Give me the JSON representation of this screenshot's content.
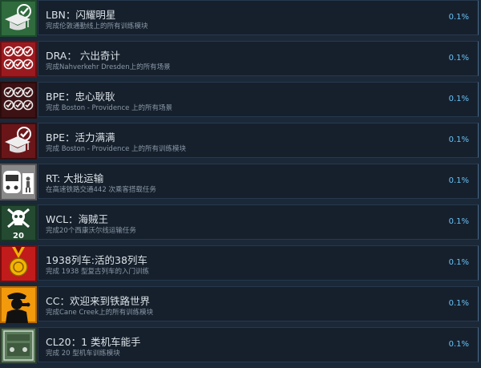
{
  "achievements": [
    {
      "title": "LBN：闪耀明星",
      "desc": "完成伦敦通勤线上的所有训练模块",
      "percent": "0.1%",
      "icon": "graduation-cap-icon"
    },
    {
      "title": "DRA： 六出奇计",
      "desc": "完成Nahverkehr Dresden上的所有场景",
      "percent": "0.1%",
      "icon": "six-checkmarks-icon"
    },
    {
      "title": "BPE：忠心耿耿",
      "desc": "完成 Boston - Providence 上的所有场景",
      "percent": "0.1%",
      "icon": "six-checkmarks-icon"
    },
    {
      "title": "BPE：活力满满",
      "desc": "完成 Boston - Providence 上的所有训练模块",
      "percent": "0.1%",
      "icon": "graduation-cap-icon"
    },
    {
      "title": "RT: 大批运输",
      "desc": "在高速铁路交通442 次乘客搭载任务",
      "percent": "0.1%",
      "icon": "train-passenger-icon"
    },
    {
      "title": "WCL：海贼王",
      "desc": "完成20个西康沃尔线运输任务",
      "percent": "0.1%",
      "icon": "skull-crossbones-icon"
    },
    {
      "title": "1938列车:活的38列车",
      "desc": "完成 1938 型复古列车的入门训练",
      "percent": "0.1%",
      "icon": "medal-icon"
    },
    {
      "title": "CC：欢迎来到铁路世界",
      "desc": "完成Cane Creek上的所有训练模块",
      "percent": "0.1%",
      "icon": "conductor-whistle-icon"
    },
    {
      "title": "CL20：1 类机车能手",
      "desc": "完成 20 型机车训练模块",
      "percent": "0.1%",
      "icon": "locomotive-class-icon"
    }
  ],
  "icon_badges": {
    "skull_count": "20"
  },
  "colors": {
    "background": "#1b2838",
    "panel": "#16202d",
    "percent": "#67c1f5",
    "title": "#dbe2e6",
    "desc": "#8b98a6"
  }
}
